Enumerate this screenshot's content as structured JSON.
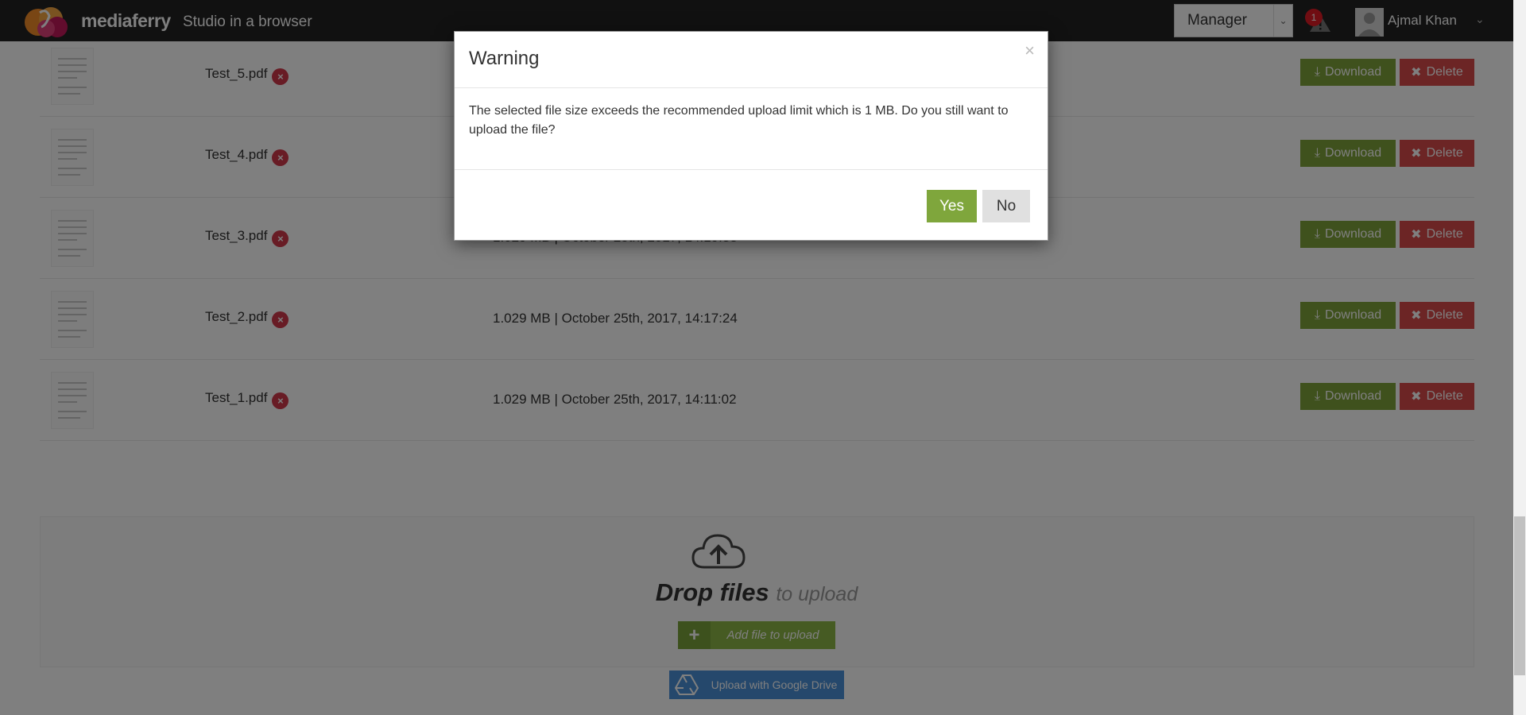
{
  "header": {
    "brand": "mediaferry",
    "tagline": "Studio in a browser",
    "role": "Manager",
    "alert_count": "1",
    "user_name": "Ajmal Khan"
  },
  "files": [
    {
      "name": "Test_5.pdf",
      "meta": ""
    },
    {
      "name": "Test_4.pdf",
      "meta": ""
    },
    {
      "name": "Test_3.pdf",
      "meta": "1.029 MB | October 25th, 2017, 14:19:33"
    },
    {
      "name": "Test_2.pdf",
      "meta": "1.029 MB | October 25th, 2017, 14:17:24"
    },
    {
      "name": "Test_1.pdf",
      "meta": "1.029 MB | October 25th, 2017, 14:11:02"
    }
  ],
  "actions": {
    "download": "Download",
    "delete": "Delete"
  },
  "upload": {
    "drop_bold": "Drop files",
    "drop_rest": "to upload",
    "add_file": "Add file to upload",
    "google_drive": "Upload with Google Drive"
  },
  "modal": {
    "title": "Warning",
    "message": "The selected file size exceeds the recommended upload limit which is 1 MB. Do you still want to upload the file?",
    "yes": "Yes",
    "no": "No",
    "close": "×"
  },
  "colors": {
    "topbar": "#222222",
    "download": "#7ea23a",
    "delete": "#d94a4a",
    "yes": "#7fa63c",
    "gdrive": "#4a90d9"
  },
  "icons": [
    "logo-icon",
    "alert-icon",
    "remove-file-icon",
    "download-icon",
    "delete-x-icon",
    "cloud-upload-icon",
    "plus-icon",
    "google-drive-icon",
    "close-icon"
  ]
}
